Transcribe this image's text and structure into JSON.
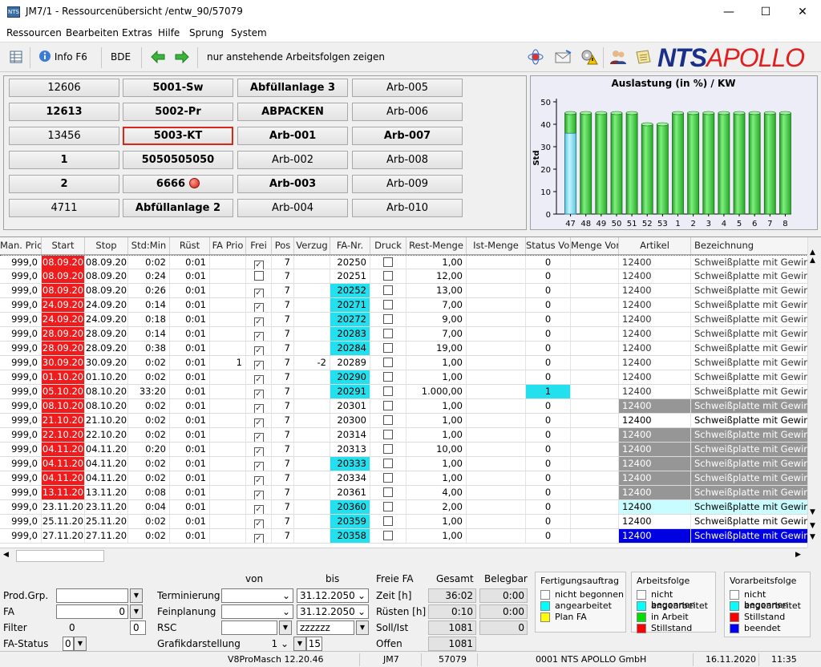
{
  "window": {
    "title": "JM7/1 - Ressourcenübersicht /entw_90/57079"
  },
  "menu": [
    "Ressourcen",
    "Bearbeiten",
    "Extras",
    "Hilfe",
    "Sprung",
    "System"
  ],
  "toolbar": {
    "info_label": "Info F6",
    "bde_label": "BDE",
    "filter_label": "nur anstehende Arbeitsfolgen zeigen",
    "brand_nts": "NTS",
    "brand_apollo": "APOLLO"
  },
  "resources": [
    [
      "12606",
      "5001-Sw",
      "Abfüllanlage 3",
      "Arb-005"
    ],
    [
      "12613",
      "5002-Pr",
      "ABPACKEN",
      "Arb-006"
    ],
    [
      "13456",
      "5003-KT",
      "Arb-001",
      "Arb-007"
    ],
    [
      "1",
      "5050505050",
      "Arb-002",
      "Arb-008"
    ],
    [
      "2",
      "6666",
      "Arb-003",
      "Arb-009"
    ],
    [
      "4711",
      "Abfüllanlage 2",
      "Arb-004",
      "Arb-010"
    ]
  ],
  "chart_data": {
    "type": "bar",
    "title": "Auslastung (in %) / KW",
    "ylabel": "Std",
    "ylim": [
      0,
      50
    ],
    "yticks": [
      0,
      10,
      20,
      30,
      40,
      50
    ],
    "categories": [
      "47",
      "48",
      "49",
      "50",
      "51",
      "52",
      "53",
      "1",
      "2",
      "3",
      "4",
      "5",
      "6",
      "7",
      "8"
    ],
    "values": [
      45,
      45,
      45,
      45,
      45,
      40,
      40,
      45,
      45,
      45,
      45,
      45,
      45,
      45,
      45
    ],
    "inner_values": [
      36,
      0,
      0,
      0,
      0,
      0,
      0,
      0,
      0,
      0,
      0,
      0,
      0,
      0,
      0
    ],
    "colors": {
      "capacity": "#3ec83e",
      "cyan": "#8ee0f0"
    }
  },
  "grid": {
    "headers": [
      "Man. Prio",
      "Start",
      "Stop",
      "Std:Min",
      "Rüst",
      "FA Prio",
      "Frei",
      "Pos",
      "Verzug",
      "FA-Nr.",
      "Druck",
      "Rest-Menge",
      "Ist-Menge",
      "Status Vor",
      "Menge Vor",
      "Artikel",
      "Bezeichnung"
    ],
    "rows": [
      [
        "999,0",
        "08.09.20",
        "08.09.20",
        "0:02",
        "0:01",
        "",
        "x",
        "7",
        "",
        "20250",
        "",
        "1,00",
        "",
        "0",
        "",
        "12400",
        "Schweißplatte mit Gewind"
      ],
      [
        "999,0",
        "08.09.20",
        "08.09.20",
        "0:24",
        "0:01",
        "",
        "",
        "7",
        "",
        "20251",
        "",
        "12,00",
        "",
        "0",
        "",
        "12400",
        "Schweißplatte mit Gewind"
      ],
      [
        "999,0",
        "08.09.20",
        "08.09.20",
        "0:26",
        "0:01",
        "",
        "x",
        "7",
        "",
        "20252",
        "",
        "13,00",
        "",
        "0",
        "",
        "12400",
        "Schweißplatte mit Gewind"
      ],
      [
        "999,0",
        "24.09.20",
        "24.09.20",
        "0:14",
        "0:01",
        "",
        "x",
        "7",
        "",
        "20271",
        "",
        "7,00",
        "",
        "0",
        "",
        "12400",
        "Schweißplatte mit Gewind"
      ],
      [
        "999,0",
        "24.09.20",
        "24.09.20",
        "0:18",
        "0:01",
        "",
        "x",
        "7",
        "",
        "20272",
        "",
        "9,00",
        "",
        "0",
        "",
        "12400",
        "Schweißplatte mit Gewind"
      ],
      [
        "999,0",
        "28.09.20",
        "28.09.20",
        "0:14",
        "0:01",
        "",
        "x",
        "7",
        "",
        "20283",
        "",
        "7,00",
        "",
        "0",
        "",
        "12400",
        "Schweißplatte mit Gewind"
      ],
      [
        "999,0",
        "28.09.20",
        "28.09.20",
        "0:38",
        "0:01",
        "",
        "x",
        "7",
        "",
        "20284",
        "",
        "19,00",
        "",
        "0",
        "",
        "12400",
        "Schweißplatte mit Gewind"
      ],
      [
        "999,0",
        "30.09.20",
        "30.09.20",
        "0:02",
        "0:01",
        "1",
        "x",
        "7",
        "-2",
        "20289",
        "",
        "1,00",
        "",
        "0",
        "",
        "12400",
        "Schweißplatte mit Gewind"
      ],
      [
        "999,0",
        "01.10.20",
        "01.10.20",
        "0:02",
        "0:01",
        "",
        "x",
        "7",
        "",
        "20290",
        "",
        "1,00",
        "",
        "0",
        "",
        "12400",
        "Schweißplatte mit Gewind"
      ],
      [
        "999,0",
        "05.10.20",
        "08.10.20",
        "33:20",
        "0:01",
        "",
        "x",
        "7",
        "",
        "20291",
        "",
        "1.000,00",
        "",
        "1",
        "",
        "12400",
        "Schweißplatte mit Gewind"
      ],
      [
        "999,0",
        "08.10.20",
        "08.10.20",
        "0:02",
        "0:01",
        "",
        "x",
        "7",
        "",
        "20301",
        "",
        "1,00",
        "",
        "0",
        "",
        "12400",
        "Schweißplatte mit Gewind"
      ],
      [
        "999,0",
        "21.10.20",
        "21.10.20",
        "0:02",
        "0:01",
        "",
        "x",
        "7",
        "",
        "20300",
        "",
        "1,00",
        "",
        "0",
        "",
        "12400",
        "Schweißplatte mit Gewind"
      ],
      [
        "999,0",
        "22.10.20",
        "22.10.20",
        "0:02",
        "0:01",
        "",
        "x",
        "7",
        "",
        "20314",
        "",
        "1,00",
        "",
        "0",
        "",
        "12400",
        "Schweißplatte mit Gewind"
      ],
      [
        "999,0",
        "04.11.20",
        "04.11.20",
        "0:20",
        "0:01",
        "",
        "x",
        "7",
        "",
        "20313",
        "",
        "10,00",
        "",
        "0",
        "",
        "12400",
        "Schweißplatte mit Gewind"
      ],
      [
        "999,0",
        "04.11.20",
        "04.11.20",
        "0:02",
        "0:01",
        "",
        "x",
        "7",
        "",
        "20333",
        "",
        "1,00",
        "",
        "0",
        "",
        "12400",
        "Schweißplatte mit Gewind"
      ],
      [
        "999,0",
        "04.11.20",
        "04.11.20",
        "0:02",
        "0:01",
        "",
        "x",
        "7",
        "",
        "20334",
        "",
        "1,00",
        "",
        "0",
        "",
        "12400",
        "Schweißplatte mit Gewind"
      ],
      [
        "999,0",
        "13.11.20",
        "13.11.20",
        "0:08",
        "0:01",
        "",
        "x",
        "7",
        "",
        "20361",
        "",
        "4,00",
        "",
        "0",
        "",
        "12400",
        "Schweißplatte mit Gewind"
      ],
      [
        "999,0",
        "23.11.20",
        "23.11.20",
        "0:04",
        "0:01",
        "",
        "x",
        "7",
        "",
        "20360",
        "",
        "2,00",
        "",
        "0",
        "",
        "12400",
        "Schweißplatte mit Gewind"
      ],
      [
        "999,0",
        "25.11.20",
        "25.11.20",
        "0:02",
        "0:01",
        "",
        "x",
        "7",
        "",
        "20359",
        "",
        "1,00",
        "",
        "0",
        "",
        "12400",
        "Schweißplatte mit Gewind"
      ],
      [
        "999,0",
        "27.11.20",
        "27.11.20",
        "0:02",
        "0:01",
        "",
        "x",
        "7",
        "",
        "20358",
        "",
        "1,00",
        "",
        "0",
        "",
        "12400",
        "Schweißplatte mit Gewind"
      ]
    ],
    "start_red_rows": 17,
    "fa_cyan_rows": [
      2,
      3,
      4,
      5,
      6,
      8,
      9,
      14,
      17,
      18,
      19
    ],
    "status_cyan_rows": [
      9
    ],
    "artikel_style": [
      "",
      "",
      "",
      "",
      "",
      "",
      "",
      "",
      "",
      "",
      "gray",
      "",
      "gray",
      "gray",
      "gray",
      "gray",
      "gray",
      "lightcyan",
      "",
      "blue"
    ]
  },
  "bottom": {
    "col_von": "von",
    "col_bis": "bis",
    "prodgrp_label": "Prod.Grp.",
    "fa_label": "FA",
    "fa_value": "0",
    "filter_label": "Filter",
    "filter_value": "0",
    "filter_value2": "0",
    "fastatus_label": "FA-Status",
    "fastatus_value": "0",
    "termin_label": "Terminierung",
    "termin_bis": "31.12.2050",
    "fein_label": "Feinplanung",
    "fein_bis": "31.12.2050",
    "rsc_label": "RSC",
    "rsc_bis": "zzzzzz",
    "grafik_label": "Grafikdarstellung",
    "grafik_von": "1",
    "grafik_bis": "15",
    "freie_fa": "Freie FA",
    "gesamt": "Gesamt",
    "belegbar": "Belegbar",
    "zeit_label": "Zeit [h]",
    "zeit_gesamt": "36:02",
    "zeit_beleg": "0:00",
    "ruesten_label": "Rüsten [h]",
    "ruesten_gesamt": "0:10",
    "ruesten_beleg": "0:00",
    "sollist_label": "Soll/Ist",
    "sollist_gesamt": "1081",
    "sollist_beleg": "0",
    "offen_label": "Offen",
    "offen_gesamt": "1081"
  },
  "legend": {
    "fert_title": "Fertigungsauftrag",
    "fert_items": [
      [
        "nicht begonnen",
        "#ffffff"
      ],
      [
        "angearbeitet",
        "#00ffff"
      ],
      [
        "Plan FA",
        "#ffff00"
      ]
    ],
    "arb_title": "Arbeitsfolge",
    "arb_items": [
      [
        "nicht begonnen",
        "#ffffff"
      ],
      [
        "angearbeitet",
        "#00ffff"
      ],
      [
        "in Arbeit",
        "#00e000"
      ],
      [
        "Stillstand",
        "#ff0000"
      ]
    ],
    "vor_title": "Vorarbeitsfolge",
    "vor_items": [
      [
        "nicht begonnen",
        "#ffffff"
      ],
      [
        "angearbeitet",
        "#00ffff"
      ],
      [
        "Stillstand",
        "#ff0000"
      ],
      [
        "beendet",
        "#0000ff"
      ]
    ]
  },
  "statusbar": [
    "V8ProMasch 12.20.46",
    "JM7",
    "57079",
    "0001 NTS APOLLO GmbH",
    "16.11.2020",
    "11:35"
  ]
}
